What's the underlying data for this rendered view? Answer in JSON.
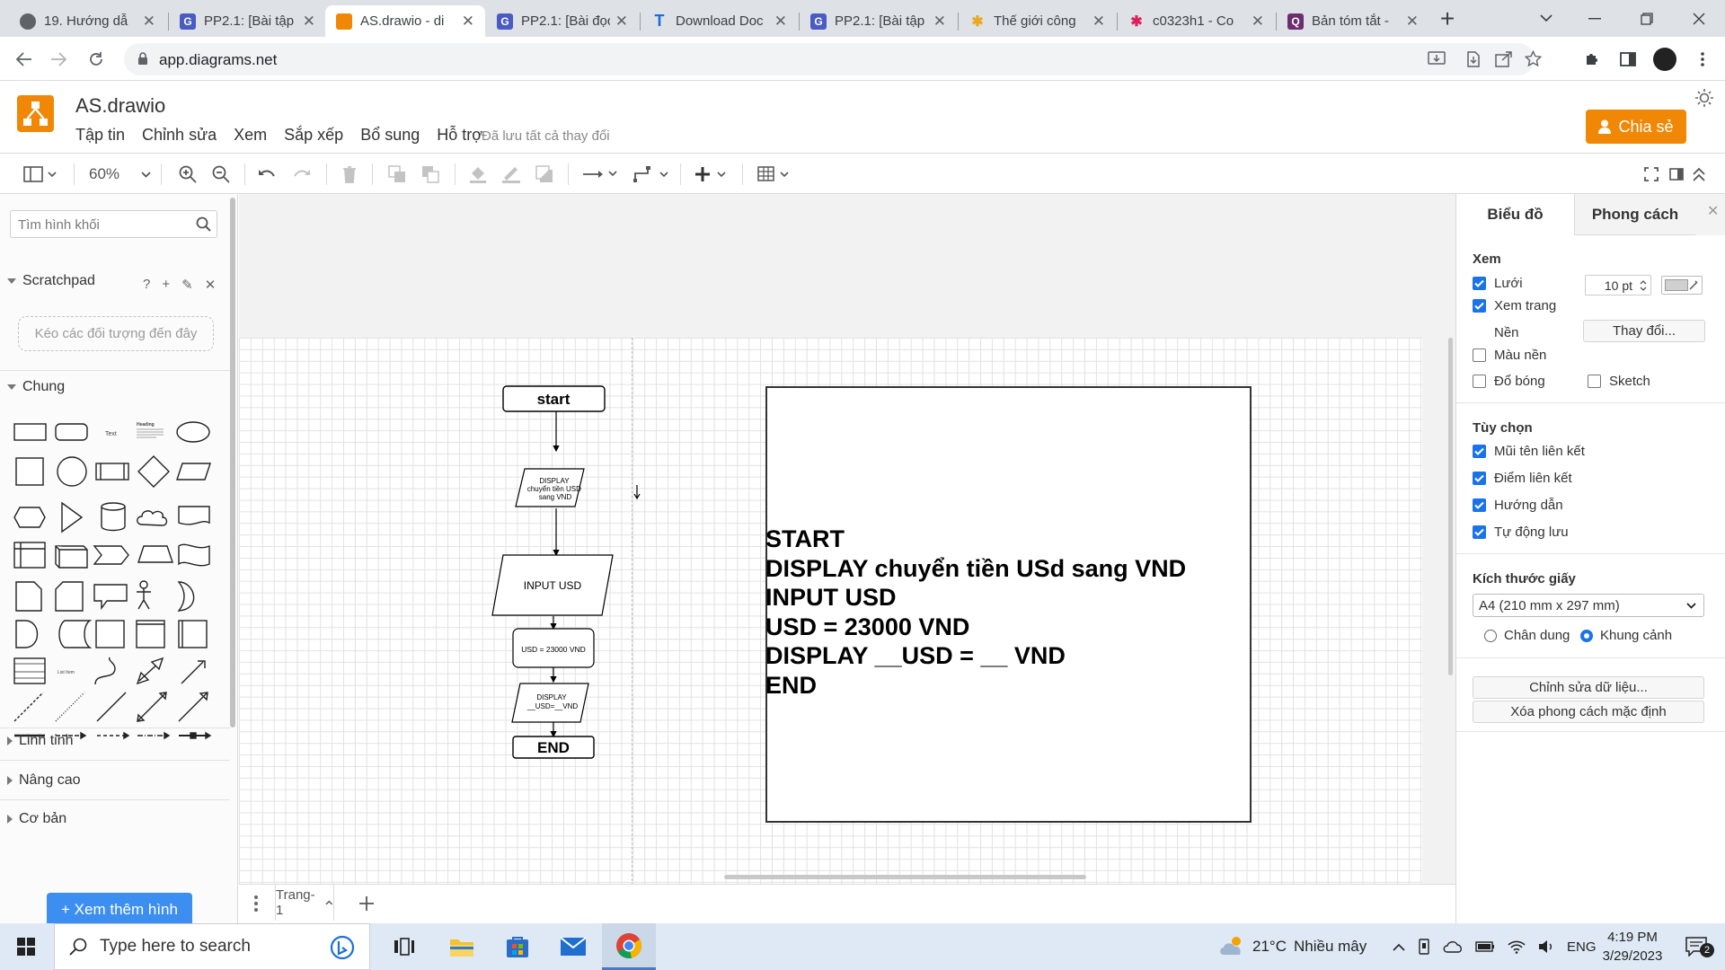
{
  "browser": {
    "tabs": [
      {
        "title": "19. Hướng dẫ",
        "icon": "edge-like-icon",
        "color": "#5f6368"
      },
      {
        "title": "PP2.1: [Bài tập",
        "icon": "g-icon",
        "color": "#4a5cc2"
      },
      {
        "title": "AS.drawio - di",
        "icon": "drawio-icon",
        "color": "#f08705"
      },
      {
        "title": "PP2.1: [Bài đọc",
        "icon": "g-icon",
        "color": "#4a5cc2"
      },
      {
        "title": "Download Doc",
        "icon": "t-icon",
        "color": "#1d6bd9"
      },
      {
        "title": "PP2.1: [Bài tập",
        "icon": "g-icon",
        "color": "#4a5cc2"
      },
      {
        "title": "Thế giới công",
        "icon": "slack-icon",
        "color": "#e9a820"
      },
      {
        "title": "c0323h1 - Co",
        "icon": "slack-icon",
        "color": "#e01e5a"
      },
      {
        "title": "Bản tóm tắt -",
        "icon": "q-icon",
        "color": "#6b2e6f"
      }
    ],
    "active_tab": 2,
    "url": "app.diagrams.net"
  },
  "app": {
    "file_title": "AS.drawio",
    "menu": [
      "Tập tin",
      "Chỉnh sửa",
      "Xem",
      "Sắp xếp",
      "Bổ sung",
      "Hỗ trợ"
    ],
    "saved_status": "Đã lưu tất cả thay đổi",
    "share_label": "Chia sẻ",
    "brand_color": "#f08705"
  },
  "toolbar": {
    "zoom": "60%"
  },
  "sidebar": {
    "search_placeholder": "Tìm hình khối",
    "scratchpad": "Scratchpad",
    "scratchpad_hint": "Kéo các đối tượng đến đây",
    "section_general": "Chung",
    "section_misc": "Linh tinh",
    "section_advanced": "Nâng cao",
    "section_basic": "Cơ bản",
    "more_shapes": "+ Xem thêm hình",
    "shape_text_label": "Text",
    "shape_heading_label": "Heading",
    "shape_list_label": "List Item"
  },
  "diagram": {
    "start": "start",
    "display1": [
      "DISPLAY",
      "chuyển tiền USD",
      "sang VND"
    ],
    "input": "INPUT USD",
    "process": "USD = 23000 VND",
    "display2": [
      "DISPLAY",
      "__USD=__VND"
    ],
    "end": "END",
    "text_block": "START\nDISPLAY chuyển tiền USd sang VND\nINPUT USD\nUSD = 23000 VND\nDISPLAY __USD = __ VND\nEND"
  },
  "page_tabs": {
    "current": "Trang-1"
  },
  "format_panel": {
    "tab_diagram": "Biểu đồ",
    "tab_style": "Phong cách",
    "view_section": "Xem",
    "grid": {
      "label": "Lưới",
      "checked": true,
      "size": "10 pt"
    },
    "page_view": {
      "label": "Xem trang",
      "checked": true
    },
    "background_label": "Nền",
    "change_button": "Thay đổi...",
    "bg_color": {
      "label": "Màu nền",
      "checked": false
    },
    "shadow": {
      "label": "Đổ bóng",
      "checked": false
    },
    "sketch": {
      "label": "Sketch",
      "checked": false
    },
    "options_section": "Tùy chọn",
    "options": [
      {
        "label": "Mũi tên liên kết",
        "checked": true
      },
      {
        "label": "Điểm liên kết",
        "checked": true
      },
      {
        "label": "Hướng dẫn",
        "checked": true
      },
      {
        "label": "Tự động lưu",
        "checked": true
      }
    ],
    "paper_section": "Kích thước giấy",
    "paper_size": "A4 (210 mm x 297 mm)",
    "portrait": "Chân dung",
    "landscape": "Khung cảnh",
    "orientation_selected": "landscape",
    "edit_data_button": "Chỉnh sửa dữ liệu...",
    "reset_style_button": "Xóa phong cách mặc định"
  },
  "taskbar": {
    "search_placeholder": "Type here to search",
    "weather_temp": "21°C",
    "weather_desc": "Nhiều mây",
    "language": "ENG",
    "time": "4:19 PM",
    "date": "3/29/2023",
    "notif_count": "2"
  }
}
